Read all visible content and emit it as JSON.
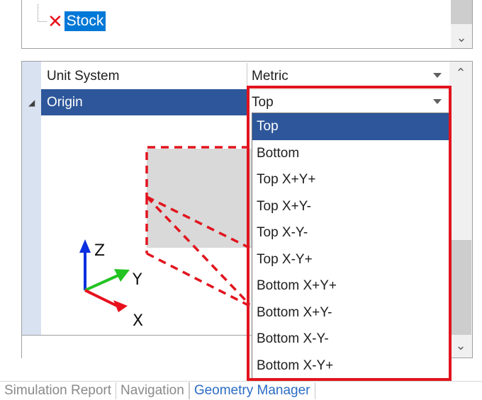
{
  "tree": {
    "item_label": "Stock",
    "item_icon": "red-x-icon",
    "scroll_down_glyph": "⌄"
  },
  "properties": [
    {
      "name": "Unit System",
      "value": "Metric"
    },
    {
      "name": "Origin",
      "value": "Top",
      "expanded": true
    }
  ],
  "diagram": {
    "axis_labels": {
      "x": "X",
      "y": "Y",
      "z": "Z"
    },
    "colors": {
      "x": "#e8101d",
      "y": "#22c322",
      "z": "#0a2ee0",
      "outline": "#e1141e",
      "face": "#d9d9d9"
    }
  },
  "origin_dropdown": {
    "selected": "Top",
    "options": [
      "Top",
      "Bottom",
      "Top X+Y+",
      "Top X+Y-",
      "Top X-Y-",
      "Top X-Y+",
      "Bottom X+Y+",
      "Bottom X+Y-",
      "Bottom X-Y-",
      "Bottom X-Y+"
    ]
  },
  "scroll": {
    "up_glyph": "⌃",
    "down_glyph": "⌄"
  },
  "tabs": [
    {
      "label": "Simulation Report",
      "active": false
    },
    {
      "label": "Navigation",
      "active": false
    },
    {
      "label": "Geometry Manager",
      "active": true
    }
  ],
  "colors": {
    "selection": "#2d579a",
    "highlight_box": "#e1141e",
    "active_tab": "#2b6cc4"
  }
}
